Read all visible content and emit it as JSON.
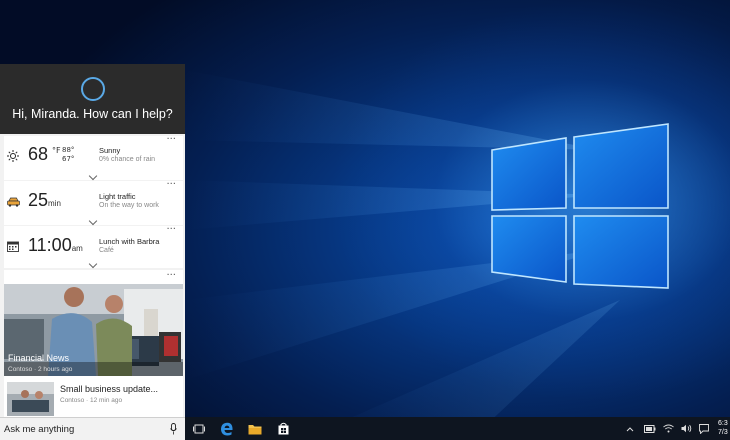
{
  "cortana": {
    "greeting": "Hi, Miranda. How can I help?",
    "more_label": "···",
    "weather": {
      "temp": "68",
      "unit": "°F",
      "high": "88°",
      "low": "67°",
      "condition": "Sunny",
      "detail": "0% chance of rain",
      "icon": "sun-icon"
    },
    "traffic": {
      "value": "25",
      "unit": "min",
      "title": "Light traffic",
      "detail": "On the way to work",
      "icon": "car-icon"
    },
    "calendar": {
      "value": "11:00",
      "unit": "am",
      "title": "Lunch with Barbra",
      "detail": "Café",
      "icon": "calendar-icon"
    },
    "news": [
      {
        "title": "Financial News",
        "meta": "Contoso · 2 hours ago"
      },
      {
        "title": "Small business update...",
        "meta": "Contoso · 12 min ago"
      }
    ]
  },
  "search": {
    "placeholder": "Ask me anything"
  },
  "taskbar": {
    "items": [
      "task-view-icon",
      "edge-icon",
      "file-explorer-icon",
      "store-icon"
    ],
    "tray": [
      "chevron-up-icon",
      "battery-icon",
      "wifi-icon",
      "volume-icon",
      "action-center-icon"
    ],
    "clock": {
      "time": "6:3",
      "date": "7/3"
    }
  },
  "colors": {
    "accent": "#5aa9e6",
    "taskbar": "#0e1520",
    "cortana_header": "#2b2b2b"
  }
}
